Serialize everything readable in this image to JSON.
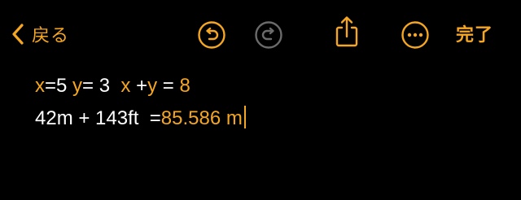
{
  "toolbar": {
    "back_label": "戻る",
    "done_label": "完了",
    "icons": {
      "back": "chevron-left-icon",
      "undo": "undo-icon",
      "redo": "redo-icon",
      "share": "share-icon",
      "more": "ellipsis-circle-icon"
    },
    "redo_enabled": false
  },
  "note": {
    "line1": {
      "var_x": "x",
      "eq_x": "=5 ",
      "var_y": "y",
      "eq_y": "= 3  ",
      "expr_x": "x",
      "plus": " +",
      "expr_y": "y",
      "eq": " = ",
      "result": "8"
    },
    "line2": {
      "expression": "42m + 143ft  =",
      "result": "85.586 m"
    }
  },
  "colors": {
    "accent": "#f5a623",
    "background": "#000000",
    "text": "#ffffff",
    "disabled": "#6b6b6b"
  }
}
